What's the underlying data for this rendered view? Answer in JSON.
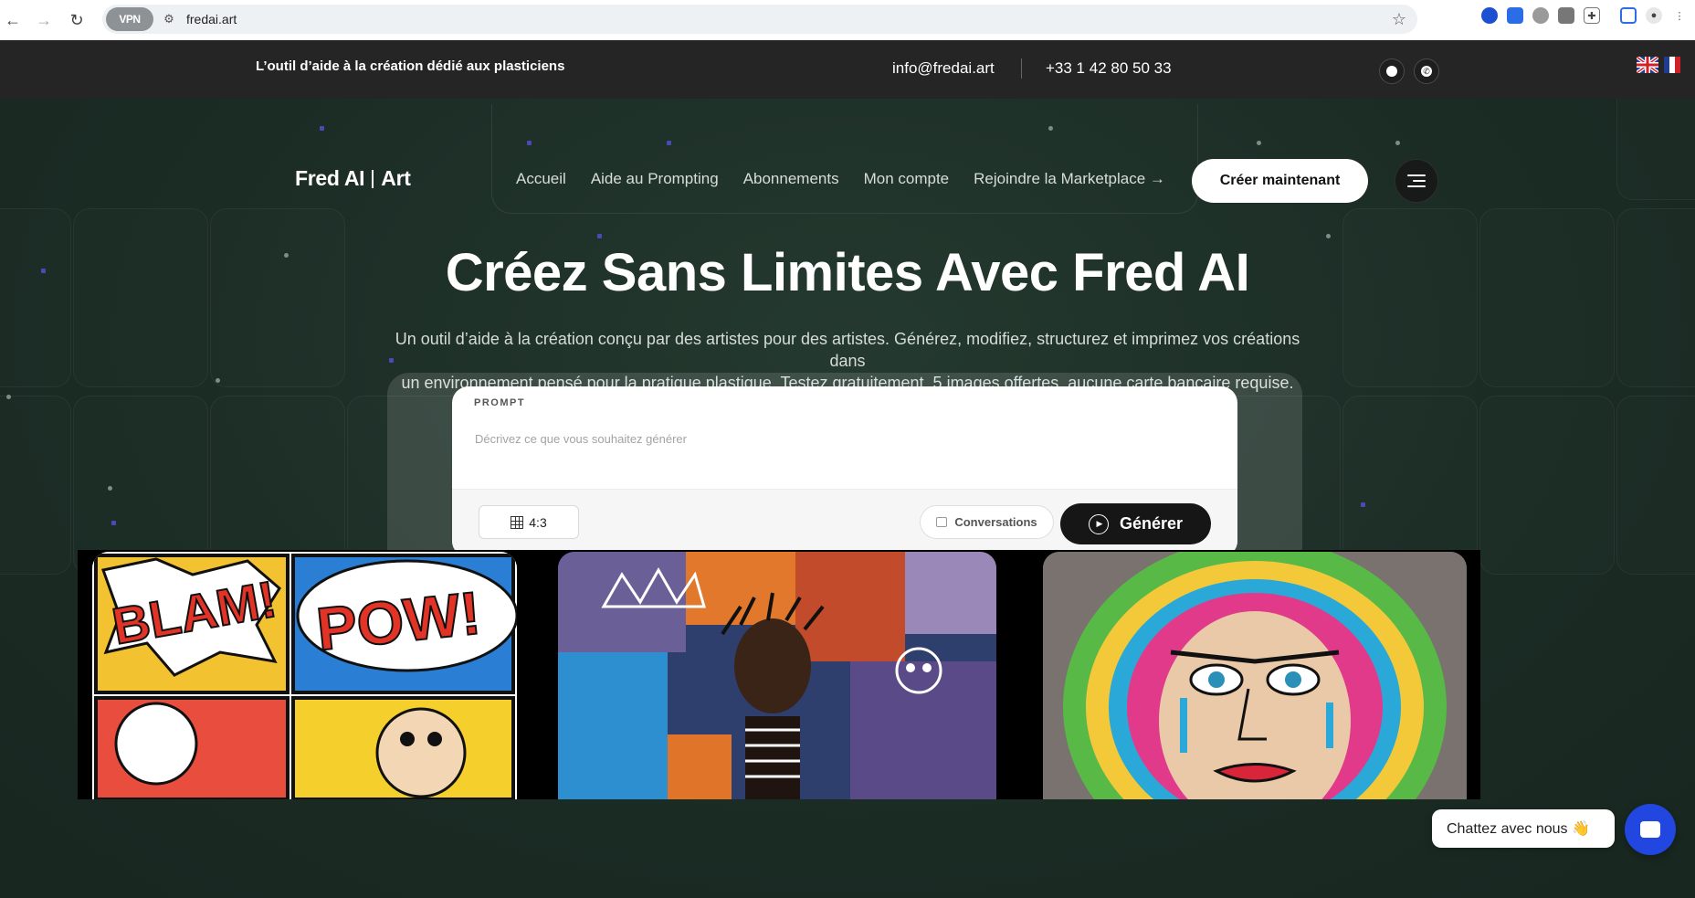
{
  "browser": {
    "vpn_label": "VPN",
    "url": "fredai.art"
  },
  "topbar": {
    "tagline": "L’outil d’aide à la création dédié aux plasticiens",
    "email": "info@fredai.art",
    "phone": "+33 1 42 80 50 33"
  },
  "header": {
    "logo_left": "Fred AI",
    "logo_right": "Art",
    "nav": [
      "Accueil",
      "Aide au Prompting",
      "Abonnements",
      "Mon compte",
      "Rejoindre la Marketplace →"
    ],
    "cta": "Créer maintenant"
  },
  "hero": {
    "title": "Créez Sans Limites Avec Fred AI",
    "subtitle_line1": "Un outil d’aide à la création conçu par des artistes pour des artistes. Générez, modifiez, structurez et imprimez vos créations dans",
    "subtitle_line2": "un environnement pensé pour la pratique plastique. Testez gratuitement. 5 images offertes, aucune carte bancaire requise."
  },
  "prompt": {
    "label": "PROMPT",
    "placeholder": "Décrivez ce que vous souhaitez générer",
    "value": "",
    "ratio": "4:3",
    "conversations": "Conversations",
    "generate": "Générer"
  },
  "gallery": {
    "art1": {
      "text_a": "BLAM!",
      "text_b": "POW!"
    }
  },
  "chat": {
    "label": "Chattez avec nous 👋"
  },
  "colors": {
    "hero_bg": "#1b2c25",
    "topbar_bg": "#242524",
    "chat_blue": "#2246e0"
  }
}
